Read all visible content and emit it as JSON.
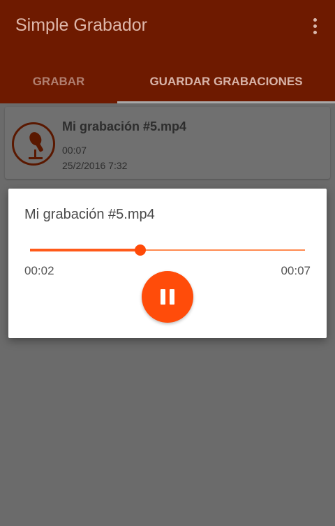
{
  "app": {
    "title": "Simple Grabador"
  },
  "tabs": [
    {
      "label": "GRABAR"
    },
    {
      "label": "GUARDAR GRABACIONES"
    }
  ],
  "recording": {
    "name": "Mi grabación #5.mp4",
    "length": "00:07",
    "date": "25/2/2016 7:32"
  },
  "player": {
    "title": "Mi grabación #5.mp4",
    "current_time": "00:02",
    "total_time": "00:07",
    "progress_percent": 40,
    "button_icon": "pause-icon"
  },
  "colors": {
    "accent": "#ff4c0a",
    "appbar_dimmed": "#6e1a00",
    "scrim": "#6b6b6b"
  }
}
